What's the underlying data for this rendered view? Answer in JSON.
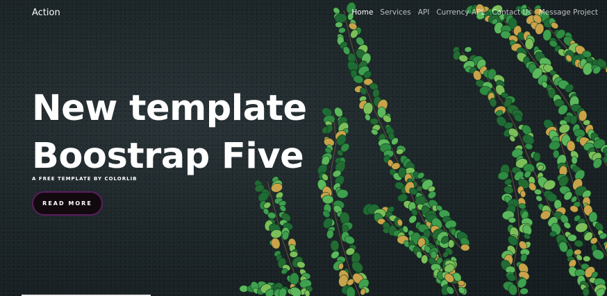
{
  "nav": {
    "brand": "Action",
    "items": [
      {
        "label": "Home",
        "active": true
      },
      {
        "label": "Services",
        "active": false
      },
      {
        "label": "API",
        "active": false
      },
      {
        "label": "Currency APL",
        "active": false
      },
      {
        "label": "Contact Us",
        "active": false
      },
      {
        "label": "Message Project",
        "active": false
      }
    ]
  },
  "hero": {
    "title_line1": "New template",
    "title_line2": "Boostrap Five",
    "subtitle": "A FREE TEMPLATE BY COLORLIB",
    "cta_label": "READ MORE"
  },
  "colors": {
    "background": "#1a2226",
    "leaf_dark": "#1f6b35",
    "leaf_light": "#3fa04f",
    "button_border": "#5c1d5e"
  },
  "icons": {
    "decor": "ivy-vines-image"
  }
}
